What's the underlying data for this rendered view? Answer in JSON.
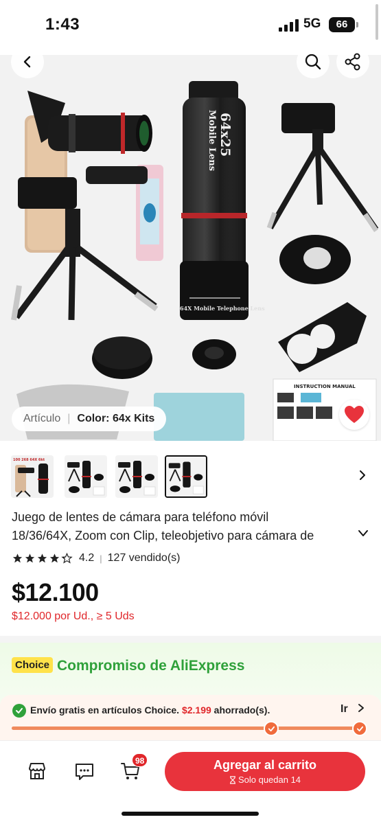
{
  "status_bar": {
    "time": "1:43",
    "network": "5G",
    "battery": "66"
  },
  "header": {
    "back_icon": "chevron-left-icon",
    "search_icon": "search-icon",
    "share_icon": "share-icon"
  },
  "product_image": {
    "lens_text_1": "Mobile Lens",
    "lens_text_2": "64x25",
    "lens_text_3": "64X Mobile Telephone Lens",
    "manual_title": "INSTRUCTION MANUAL"
  },
  "variant_chip": {
    "label": "Artículo",
    "value": "Color: 64x Kits"
  },
  "thumb_badge": "100 268 64X 6kt",
  "product": {
    "title_line1": "Juego de lentes de cámara para teléfono móvil",
    "title_line2": "18/36/64X, Zoom con Clip, teleobjetivo para cámara de",
    "rating": "4.2",
    "rating_stars": 4.2,
    "sold": "127 vendido(s)",
    "price": "$12.100",
    "bulk_price": "$12.000 por Ud., ≥ 5 Uds"
  },
  "choice": {
    "badge": "Choice",
    "title": "Compromiso de AliExpress",
    "shipping_text": "Envío gratis en artículos Choice.",
    "saved_amount": "$2.199",
    "saved_label": "ahorrado(s).",
    "action": "Ir",
    "progress": 1.0
  },
  "bottom_bar": {
    "cart_count": "98",
    "add_to_cart": "Agregar al carrito",
    "stock_note": "Solo quedan 14"
  },
  "colors": {
    "accent_red": "#e8333c",
    "price_red": "#e0262a",
    "choice_green": "#2fa13a",
    "choice_yellow": "#ffe24a"
  }
}
